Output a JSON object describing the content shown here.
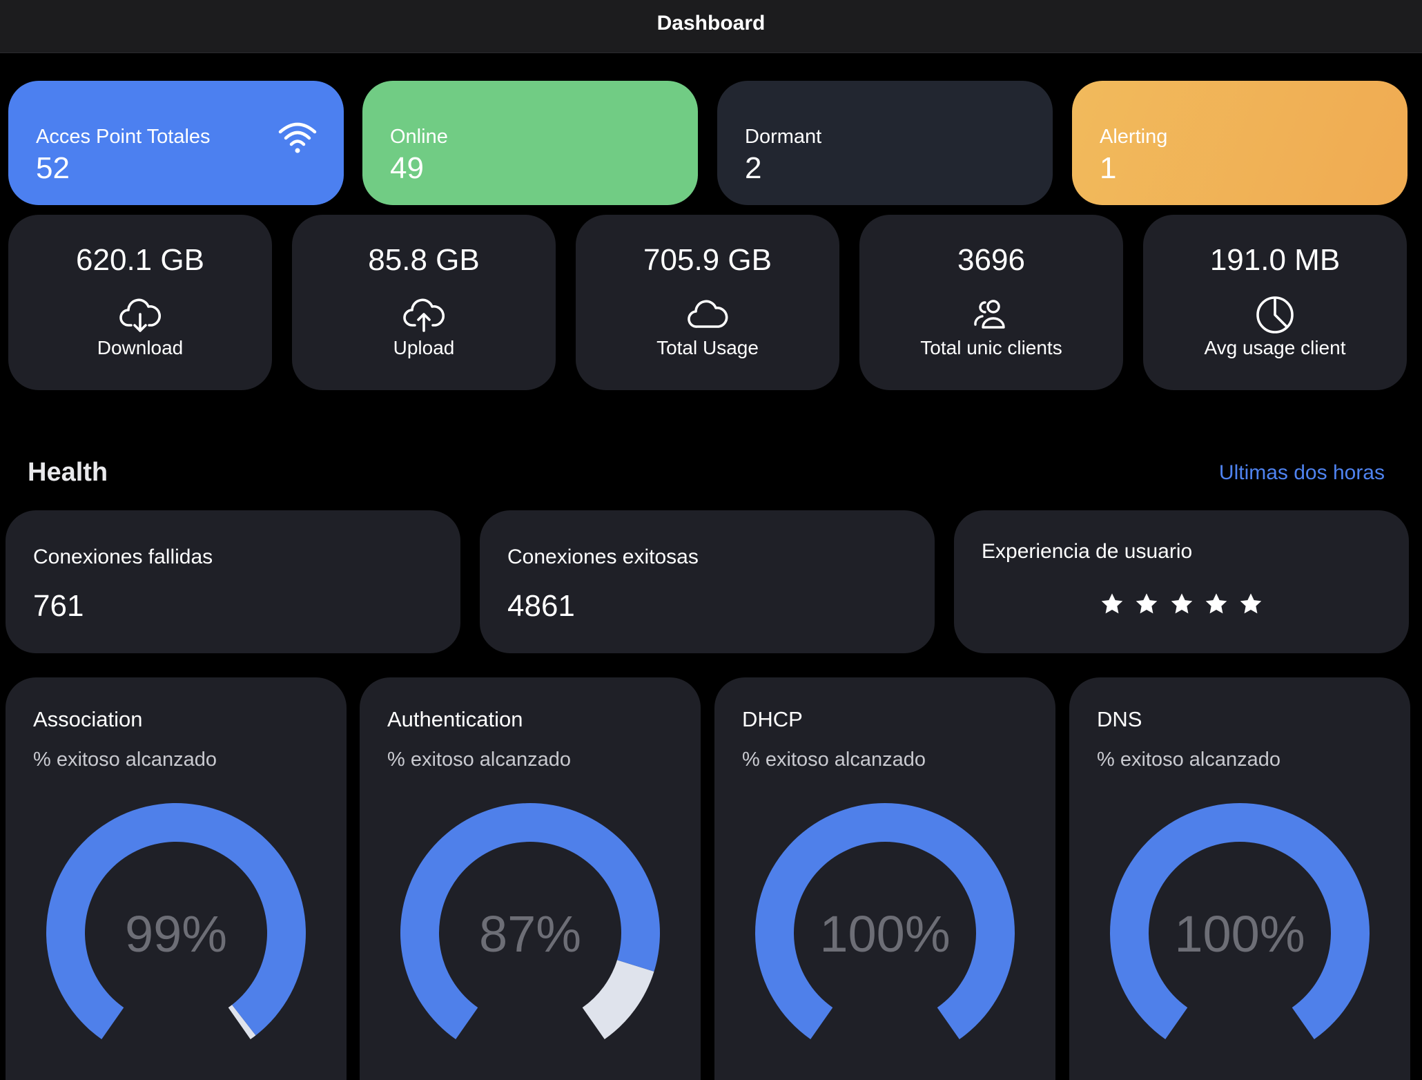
{
  "header": {
    "title": "Dashboard"
  },
  "status_cards": [
    {
      "label": "Acces Point Totales",
      "value": "52",
      "color": "#4c80f0",
      "icon": "wifi-icon"
    },
    {
      "label": "Online",
      "value": "49",
      "color": "#71cc84"
    },
    {
      "label": "Dormant",
      "value": "2",
      "color": "#222630"
    },
    {
      "label": "Alerting",
      "value": "1",
      "color": "#f0ab52"
    }
  ],
  "metrics": [
    {
      "value": "620.1 GB",
      "label": "Download",
      "icon": "cloud-download-icon"
    },
    {
      "value": "85.8 GB",
      "label": "Upload",
      "icon": "cloud-upload-icon"
    },
    {
      "value": "705.9 GB",
      "label": "Total Usage",
      "icon": "cloud-icon"
    },
    {
      "value": "3696",
      "label": "Total unic clients",
      "icon": "users-icon"
    },
    {
      "value": "191.0 MB",
      "label": "Avg usage client",
      "icon": "pie-chart-icon"
    }
  ],
  "health": {
    "title": "Health",
    "period_link": "Ultimas dos horas",
    "failed": {
      "label": "Conexiones fallidas",
      "value": "761"
    },
    "success": {
      "label": "Conexiones exitosas",
      "value": "4861"
    },
    "experience": {
      "label": "Experiencia de usuario",
      "rating": 5,
      "max_rating": 5
    }
  },
  "gauges": [
    {
      "title": "Association",
      "subtitle": "% exitoso alcanzado",
      "value_text": "99%",
      "percent": 99
    },
    {
      "title": "Authentication",
      "subtitle": "% exitoso alcanzado",
      "value_text": "87%",
      "percent": 87
    },
    {
      "title": "DHCP",
      "subtitle": "% exitoso alcanzado",
      "value_text": "100%",
      "percent": 100
    },
    {
      "title": "DNS",
      "subtitle": "% exitoso alcanzado",
      "value_text": "100%",
      "percent": 100
    }
  ],
  "colors": {
    "accent": "#4c80f0",
    "link": "#4f83f0",
    "gauge_fill": "#4f80ea",
    "gauge_remainder": "#dfe3ec",
    "gauge_text": "#6d6e76",
    "card": "#1f2027"
  }
}
